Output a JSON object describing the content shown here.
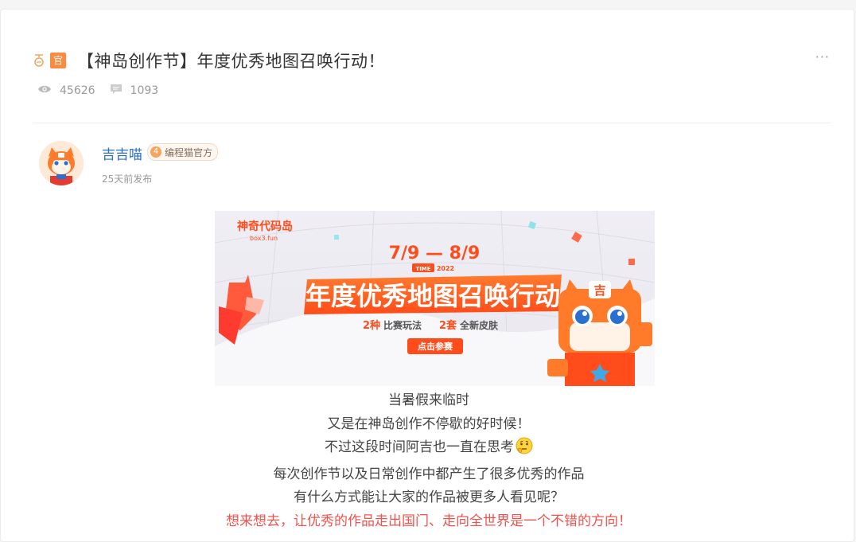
{
  "post": {
    "badge": "官",
    "title": "【神岛创作节】年度优秀地图召唤行动！",
    "more": "···",
    "views": "45626",
    "comments": "1093"
  },
  "author": {
    "name": "吉吉喵",
    "level": "4",
    "tag": "编程猫官方",
    "time": "25天前发布"
  },
  "banner": {
    "logo_main": "神奇代码岛",
    "logo_sub": "box3.fun",
    "date": "7/9 — 8/9",
    "time_label": "TIME",
    "year": "2022",
    "headline": "年度优秀地图召唤行动",
    "sub_num1": "2种",
    "sub_text1": "比赛玩法",
    "sub_num2": "2套",
    "sub_text2": "全新皮肤",
    "cta": "点击参赛",
    "mascot_char": "吉"
  },
  "content": {
    "line1": "当暑假来临时",
    "line2": "又是在神岛创作不停歇的好时候！",
    "line3": "不过这段时间阿吉也一直在思考",
    "line4": "每次创作节以及日常创作中都产生了很多优秀的作品",
    "line5": "有什么方式能让大家的作品被更多人看见呢？",
    "line6": "想来想去，让优秀的作品走出国门、走向全世界是一个不错的方向！"
  },
  "colors": {
    "accent": "#ff8a3d",
    "author_link": "#2a6fc9",
    "highlight_text": "#f0534e",
    "banner_orange": "#ff5a1f"
  },
  "icons": [
    "pin-icon",
    "eye-icon",
    "comment-icon",
    "more-icon",
    "thinking-emoji-icon"
  ]
}
